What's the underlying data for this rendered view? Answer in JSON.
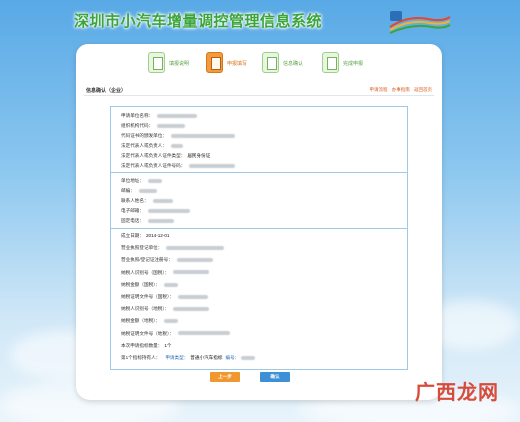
{
  "site": {
    "title": "深圳市小汽车增量调控管理信息系统"
  },
  "logo": {
    "text": "",
    "sub": ""
  },
  "steps": [
    {
      "label": "填报说明",
      "active": false
    },
    {
      "label": "申报填写",
      "active": true
    },
    {
      "label": "信息确认",
      "active": false
    },
    {
      "label": "完成申报",
      "active": false
    }
  ],
  "section": {
    "title": "信息确认（企业）",
    "links": [
      "申请流程",
      "办事指南",
      "返回首页"
    ]
  },
  "block1": [
    {
      "k": "申请单位名称：",
      "v": "",
      "blur": 40
    },
    {
      "k": "组织机构代码：",
      "v": "",
      "blur": 28
    },
    {
      "k": "代码证书的颁发单位：",
      "v": "",
      "blur": 64
    },
    {
      "k": "法定代表人或负责人：",
      "v": "",
      "blur": 12
    },
    {
      "k": "法定代表人或负责人证件类型：",
      "v": "居民身份证",
      "blur": 0
    },
    {
      "k": "法定代表人或负责人证件号码：",
      "v": "",
      "blur": 46
    }
  ],
  "block2": [
    {
      "k": "单位地址：",
      "v": "",
      "blur": 14
    },
    {
      "k": "邮编：",
      "v": "",
      "blur": 18
    },
    {
      "k": "联系人姓名：",
      "v": "",
      "blur": 20
    },
    {
      "k": "电子邮箱：",
      "v": "",
      "blur": 42
    },
    {
      "k": "固定电话：",
      "v": "",
      "blur": 26
    }
  ],
  "block3": [
    {
      "k": "成立日期：",
      "v": "2014-12-01",
      "blur": 0
    },
    {
      "k": "营业执照登记单位：",
      "v": "",
      "blur": 58
    },
    {
      "k": "营业执照/登记证注册号：",
      "v": "",
      "blur": 36
    },
    {
      "k": "纳税人识别号（国税）：",
      "v": "",
      "blur": 36
    },
    {
      "k": "纳税金额（国税）：",
      "v": "",
      "blur": 14
    },
    {
      "k": "纳税证明文件号（国税）：",
      "v": "",
      "blur": 30
    },
    {
      "k": "纳税人识别号（地税）：",
      "v": "",
      "blur": 36
    },
    {
      "k": "纳税金额（地税）：",
      "v": "",
      "blur": 14
    },
    {
      "k": "纳税证明文件号（地税）：",
      "v": "",
      "blur": 52
    },
    {
      "k": "本次申请指标数量：",
      "v": "1个",
      "blur": 0
    },
    {
      "k": "第1个指标持有人：",
      "v": "",
      "blur": 0,
      "extra": [
        {
          "type": "link",
          "text": "申请类型："
        },
        {
          "type": "text",
          "text": "普通小汽车指标"
        },
        {
          "type": "link",
          "text": "编号："
        }
      ],
      "blurEnd": 14
    }
  ],
  "buttons": {
    "prev": "上一步",
    "confirm": "确认"
  },
  "watermark": {
    "main": "广西龙网",
    "sub": ""
  }
}
